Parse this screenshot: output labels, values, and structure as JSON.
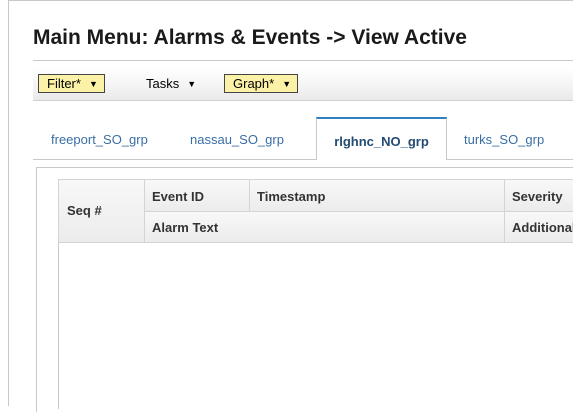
{
  "page": {
    "title": "Main Menu: Alarms & Events -> View Active"
  },
  "toolbar": {
    "filter_label": "Filter*",
    "tasks_label": "Tasks",
    "graph_label": "Graph*",
    "highlight_color": "#fbf1a7"
  },
  "tabs": [
    {
      "label": "freeport_SO_grp",
      "active": false
    },
    {
      "label": "nassau_SO_grp",
      "active": false
    },
    {
      "label": "rlghnc_NO_grp",
      "active": true
    },
    {
      "label": "turks_SO_grp",
      "active": false
    }
  ],
  "table": {
    "columns": {
      "seq": "Seq #",
      "event_id": "Event ID",
      "timestamp": "Timestamp",
      "severity": "Severity",
      "alarm_text": "Alarm Text",
      "additional": "Additional"
    },
    "rows": []
  },
  "colors": {
    "active_tab_accent": "#2f80c2",
    "tab_link": "#3a6ea5"
  }
}
